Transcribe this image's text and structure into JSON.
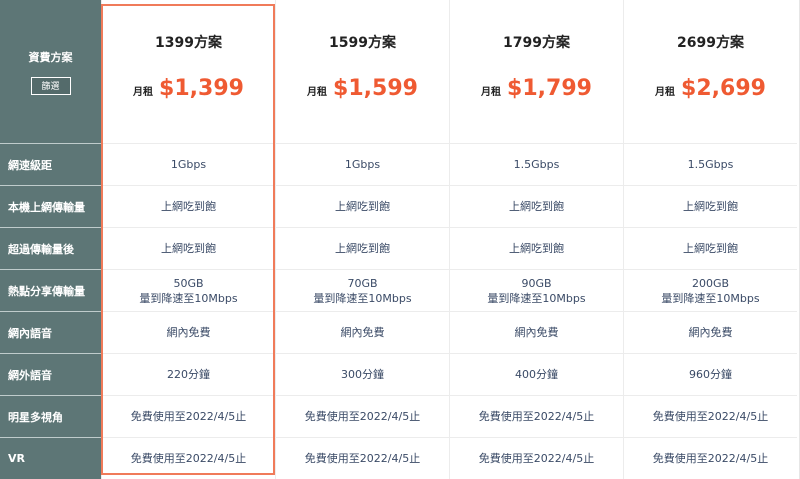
{
  "sidebar": {
    "header_label": "資費方案",
    "filter_label": "篩選",
    "rows": [
      "網速級距",
      "本機上網傳輸量",
      "超過傳輸量後",
      "熱點分享傳輸量",
      "網內語音",
      "網外語音",
      "明星多視角",
      "VR"
    ]
  },
  "plans": [
    {
      "name": "1399方案",
      "monthly_label": "月租",
      "price": "$1,399",
      "cells": [
        [
          "1Gbps"
        ],
        [
          "上網吃到飽"
        ],
        [
          "上網吃到飽"
        ],
        [
          "50GB",
          "量到降速至10Mbps"
        ],
        [
          "網內免費"
        ],
        [
          "220分鐘"
        ],
        [
          "免費使用至2022/4/5止"
        ],
        [
          "免費使用至2022/4/5止"
        ]
      ]
    },
    {
      "name": "1599方案",
      "monthly_label": "月租",
      "price": "$1,599",
      "cells": [
        [
          "1Gbps"
        ],
        [
          "上網吃到飽"
        ],
        [
          "上網吃到飽"
        ],
        [
          "70GB",
          "量到降速至10Mbps"
        ],
        [
          "網內免費"
        ],
        [
          "300分鐘"
        ],
        [
          "免費使用至2022/4/5止"
        ],
        [
          "免費使用至2022/4/5止"
        ]
      ]
    },
    {
      "name": "1799方案",
      "monthly_label": "月租",
      "price": "$1,799",
      "cells": [
        [
          "1.5Gbps"
        ],
        [
          "上網吃到飽"
        ],
        [
          "上網吃到飽"
        ],
        [
          "90GB",
          "量到降速至10Mbps"
        ],
        [
          "網內免費"
        ],
        [
          "400分鐘"
        ],
        [
          "免費使用至2022/4/5止"
        ],
        [
          "免費使用至2022/4/5止"
        ]
      ]
    },
    {
      "name": "2699方案",
      "monthly_label": "月租",
      "price": "$2,699",
      "cells": [
        [
          "1.5Gbps"
        ],
        [
          "上網吃到飽"
        ],
        [
          "上網吃到飽"
        ],
        [
          "200GB",
          "量到降速至10Mbps"
        ],
        [
          "網內免費"
        ],
        [
          "960分鐘"
        ],
        [
          "免費使用至2022/4/5止"
        ],
        [
          "免費使用至2022/4/5止"
        ]
      ]
    }
  ],
  "colors": {
    "sidebar_bg": "#5d7676",
    "price_accent": "#ef5a32",
    "highlight_border": "#f07b5a",
    "cell_text": "#3a4a66"
  },
  "selected_plan_index": 0
}
